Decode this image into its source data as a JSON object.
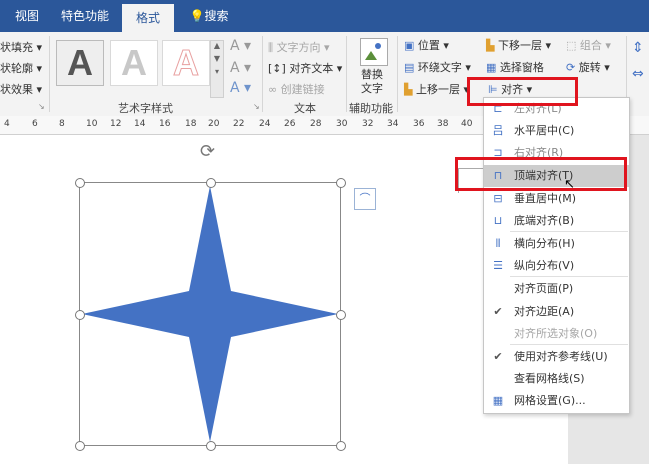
{
  "tabs": {
    "view": "视图",
    "special": "特色功能",
    "format": "格式",
    "search": "搜索"
  },
  "ribbon": {
    "shape_fill": "状填充",
    "shape_outline": "状轮廓",
    "shape_effect": "状效果",
    "wordart_group": "艺术字样式",
    "text_direction": "文字方向",
    "align_text": "对齐文本",
    "create_link": "创建链接",
    "text_group": "文本",
    "alt_text": "替换\n文字",
    "alt_text_l1": "替换",
    "alt_text_l2": "文字",
    "aux_group": "辅助功能",
    "position": "位置",
    "wrap_text": "环绕文字",
    "bring_forward": "上移一层",
    "send_backward": "下移一层",
    "selection_pane": "选择窗格",
    "align": "对齐",
    "group": "组合",
    "rotate": "旋转"
  },
  "ruler_ticks": [
    "4",
    "6",
    "8",
    "10",
    "12",
    "14",
    "16",
    "18",
    "20",
    "22",
    "24",
    "26",
    "28",
    "30",
    "32",
    "34",
    "36",
    "38",
    "40"
  ],
  "align_menu": {
    "items": [
      {
        "label": "左对齐(L)",
        "icon": "align-left-icon",
        "state": "partial"
      },
      {
        "label": "水平居中(C)",
        "icon": "align-center-icon"
      },
      {
        "label": "右对齐(R)",
        "icon": "align-right-icon",
        "state": "partial"
      },
      {
        "label": "顶端对齐(T)",
        "icon": "align-top-icon",
        "state": "highlight"
      },
      {
        "label": "垂直居中(M)",
        "icon": "align-middle-icon"
      },
      {
        "label": "底端对齐(B)",
        "icon": "align-bottom-icon"
      },
      {
        "label": "横向分布(H)",
        "icon": "distribute-horizontal-icon"
      },
      {
        "label": "纵向分布(V)",
        "icon": "distribute-vertical-icon"
      },
      {
        "label": "对齐页面(P)"
      },
      {
        "label": "对齐边距(A)",
        "checked": true
      },
      {
        "label": "对齐所选对象(O)",
        "disabled": true
      },
      {
        "label": "使用对齐参考线(U)",
        "checked": true
      },
      {
        "label": "查看网格线(S)"
      },
      {
        "label": "网格设置(G)...",
        "icon": "grid-icon"
      }
    ]
  },
  "colors": {
    "accent": "#2b579a",
    "star": "#4472c4",
    "highlight_box": "#e0141e"
  }
}
